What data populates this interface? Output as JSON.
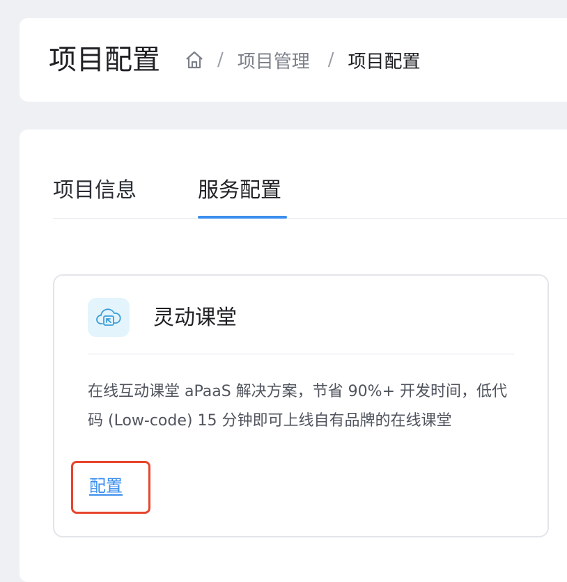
{
  "header": {
    "title": "项目配置",
    "breadcrumb": {
      "home_icon": "home-icon",
      "separator": "/",
      "items": [
        "项目管理",
        "项目配置"
      ]
    }
  },
  "tabs": [
    {
      "label": "项目信息",
      "active": false
    },
    {
      "label": "服务配置",
      "active": true
    }
  ],
  "service_card": {
    "icon": "cloud-classroom-icon",
    "name": "灵动课堂",
    "description": "在线互动课堂 aPaaS 解决方案，节省 90%+ 开发时间，低代码 (Low-code) 15 分钟即可上线自有品牌的在线课堂",
    "action_label": "配置"
  },
  "colors": {
    "accent": "#3b8eed",
    "highlight_border": "#e8442d",
    "background": "#eff0f3",
    "icon_bg": "#e3f4fc"
  }
}
